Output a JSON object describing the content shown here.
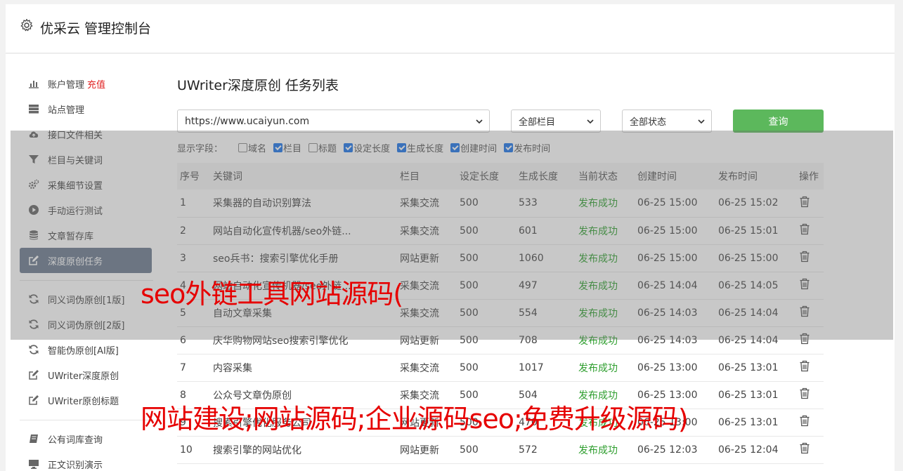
{
  "header": {
    "title": "优采云 管理控制台"
  },
  "sidebar": {
    "groups": [
      [
        {
          "label": "账户管理",
          "extra": "充值",
          "icon": "bar-chart-icon"
        },
        {
          "label": "站点管理",
          "icon": "server-icon"
        },
        {
          "label": "接口文件相关",
          "icon": "cloud-upload-icon"
        },
        {
          "label": "栏目与关键词",
          "icon": "filter-icon"
        },
        {
          "label": "采集细节设置",
          "icon": "cogs-icon"
        },
        {
          "label": "手动运行测试",
          "icon": "play-icon"
        },
        {
          "label": "文章暂存库",
          "icon": "database-icon"
        },
        {
          "label": "深度原创任务",
          "icon": "edit-icon",
          "active": true
        }
      ],
      [
        {
          "label": "同义词伪原创[1版]",
          "icon": "refresh-icon"
        },
        {
          "label": "同义词伪原创[2版]",
          "icon": "refresh-icon"
        },
        {
          "label": "智能伪原创[AI版]",
          "icon": "refresh-icon"
        },
        {
          "label": "UWriter深度原创",
          "icon": "edit-icon"
        },
        {
          "label": "UWriter原创标题",
          "icon": "edit-icon"
        }
      ],
      [
        {
          "label": "公有词库查询",
          "icon": "book-icon"
        },
        {
          "label": "正文识别演示",
          "icon": "monitor-icon"
        }
      ]
    ]
  },
  "main": {
    "title": "UWriter深度原创 任务列表",
    "site_select": "https://www.ucaiyun.com",
    "column_select": "全部栏目",
    "status_select": "全部状态",
    "query_label": "查询",
    "fields_label": "显示字段：",
    "fields": [
      {
        "label": "域名",
        "checked": false
      },
      {
        "label": "栏目",
        "checked": true
      },
      {
        "label": "标题",
        "checked": false
      },
      {
        "label": "设定长度",
        "checked": true
      },
      {
        "label": "生成长度",
        "checked": true
      },
      {
        "label": "创建时间",
        "checked": true
      },
      {
        "label": "发布时间",
        "checked": true
      }
    ],
    "columns": [
      "序号",
      "关键词",
      "栏目",
      "设定长度",
      "生成长度",
      "当前状态",
      "创建时间",
      "发布时间",
      "操作"
    ],
    "rows": [
      [
        "1",
        "采集器的自动识别算法",
        "采集交流",
        "500",
        "533",
        "发布成功",
        "06-25 15:00",
        "06-25 15:02"
      ],
      [
        "2",
        "网站自动化宣传机器/seo外链...",
        "采集交流",
        "500",
        "601",
        "发布成功",
        "06-25 15:00",
        "06-25 15:01"
      ],
      [
        "3",
        "seo兵书：搜索引擎优化手册",
        "网站更新",
        "500",
        "1060",
        "发布成功",
        "06-25 15:00",
        "06-25 15:00"
      ],
      [
        "4",
        "网站自动化宣传机器/seo外链...",
        "采集交流",
        "500",
        "497",
        "发布成功",
        "06-25 14:04",
        "06-25 14:05"
      ],
      [
        "5",
        "自动文章采集",
        "采集交流",
        "500",
        "554",
        "发布成功",
        "06-25 14:03",
        "06-25 14:04"
      ],
      [
        "6",
        "庆华购物网站seo搜索引擎优化",
        "网站更新",
        "500",
        "708",
        "发布成功",
        "06-25 14:03",
        "06-25 14:04"
      ],
      [
        "7",
        "内容采集",
        "采集交流",
        "500",
        "1017",
        "发布成功",
        "06-25 13:00",
        "06-25 13:01"
      ],
      [
        "8",
        "公众号文章伪原创",
        "采集交流",
        "500",
        "504",
        "发布成功",
        "06-25 13:00",
        "06-25 13:01"
      ],
      [
        "9",
        "搜索引擎优化服务公司",
        "网站更新",
        "500",
        "470",
        "发布成功",
        "06-25 13:00",
        "06-25 13:01"
      ],
      [
        "10",
        "搜索引擎的网站优化",
        "网站更新",
        "500",
        "572",
        "发布成功",
        "06-25 12:03",
        "06-25 12:04"
      ]
    ]
  },
  "watermarks": {
    "top": "seo外链工具网站源码(",
    "bottom": "网站建设;网站源码;企业源码seo;免费升级源码)"
  },
  "colors": {
    "active_nav": "#6b7a8f",
    "query_button": "#5cb85c",
    "success": "#2e9e2e",
    "recharge": "#e02020",
    "watermark": "#e60000"
  }
}
